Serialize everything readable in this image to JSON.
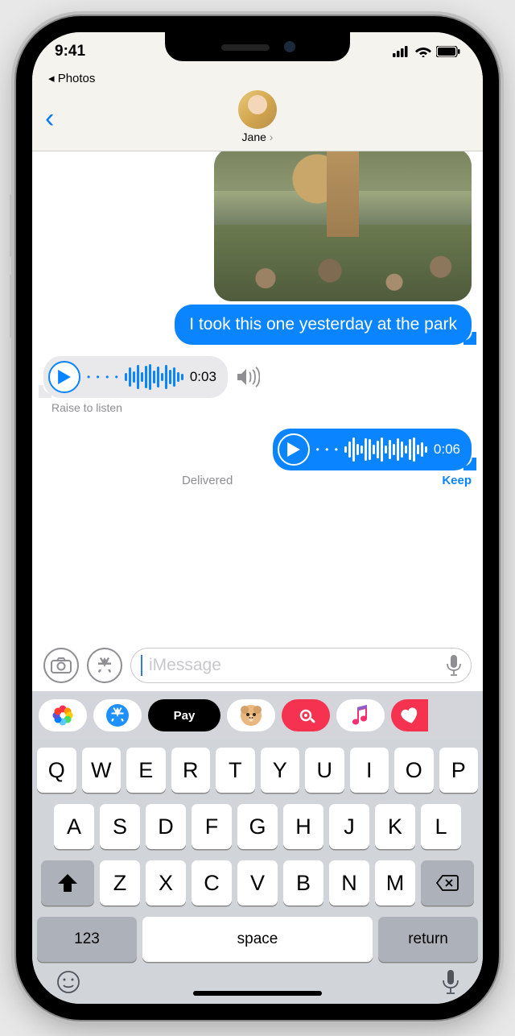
{
  "status": {
    "time": "9:41",
    "back_app": "◂ Photos"
  },
  "contact": {
    "name": "Jane"
  },
  "messages": {
    "sent_text": "I took this one yesterday at the park",
    "voice_in": {
      "duration": "0:03",
      "hint": "Raise to listen"
    },
    "voice_out": {
      "duration": "0:06",
      "status": "Delivered",
      "keep": "Keep"
    }
  },
  "input": {
    "placeholder": "iMessage"
  },
  "apps": {
    "pay": " Pay"
  },
  "keyboard": {
    "row1": [
      "Q",
      "W",
      "E",
      "R",
      "T",
      "Y",
      "U",
      "I",
      "O",
      "P"
    ],
    "row2": [
      "A",
      "S",
      "D",
      "F",
      "G",
      "H",
      "J",
      "K",
      "L"
    ],
    "row3": [
      "Z",
      "X",
      "C",
      "V",
      "B",
      "N",
      "M"
    ],
    "numbers": "123",
    "space": "space",
    "return": "return"
  }
}
